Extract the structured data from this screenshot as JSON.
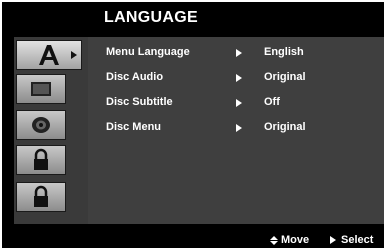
{
  "header": {
    "title": "LANGUAGE"
  },
  "sidebar": {
    "items": [
      {
        "icon": "language-a-icon",
        "active": true
      },
      {
        "icon": "display-icon",
        "active": false
      },
      {
        "icon": "audio-speaker-icon",
        "active": false
      },
      {
        "icon": "lock-icon",
        "active": false
      },
      {
        "icon": "others-lock-icon",
        "active": false
      }
    ]
  },
  "menu": {
    "rows": [
      {
        "label": "Menu Language",
        "value": "English"
      },
      {
        "label": "Disc Audio",
        "value": "Original"
      },
      {
        "label": "Disc Subtitle",
        "value": "Off"
      },
      {
        "label": "Disc Menu",
        "value": "Original"
      }
    ]
  },
  "footer": {
    "move_label": "Move",
    "select_label": "Select"
  },
  "colors": {
    "background": "#000000",
    "panel": "#3a3a3a",
    "text": "#ffffff"
  }
}
